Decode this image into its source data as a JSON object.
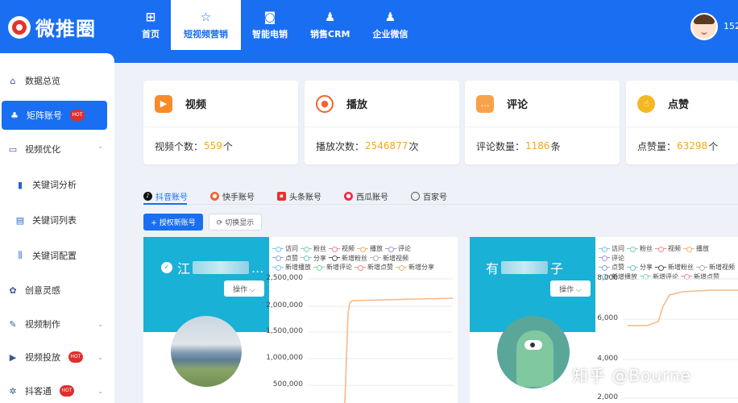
{
  "app": {
    "title": "微推圈"
  },
  "nav": [
    {
      "label": "首页",
      "icon": "grid-icon",
      "glyph": "⊞"
    },
    {
      "label": "短视频营销",
      "icon": "star-icon",
      "glyph": "☆"
    },
    {
      "label": "智能电销",
      "icon": "robot-icon",
      "glyph": "◙"
    },
    {
      "label": "销售CRM",
      "icon": "people-icon",
      "glyph": "♟"
    },
    {
      "label": "企业微信",
      "icon": "user-icon",
      "glyph": "♟"
    }
  ],
  "user": {
    "id_text": "152"
  },
  "sidebar": {
    "items": [
      {
        "label": "数据总览",
        "glyph": "⌂"
      },
      {
        "label": "矩阵账号",
        "glyph": "♣",
        "badge": "HOT"
      },
      {
        "label": "视频优化",
        "glyph": "▭",
        "caret": "⌃"
      },
      {
        "label": "关键词分析",
        "glyph": "▮"
      },
      {
        "label": "关键词列表",
        "glyph": "▤"
      },
      {
        "label": "关键词配置",
        "glyph": "⫼"
      },
      {
        "label": "创意灵感",
        "glyph": "✿"
      },
      {
        "label": "视频制作",
        "glyph": "✎",
        "caret": "⌄"
      },
      {
        "label": "视频投放",
        "glyph": "▶",
        "badge": "HOT",
        "caret": "⌄"
      },
      {
        "label": "抖客通",
        "glyph": "✲",
        "badge": "HOT",
        "caret": "⌄"
      }
    ]
  },
  "stats": [
    {
      "title": "视频",
      "label": "视频个数：",
      "value": "559",
      "unit": "个",
      "color": "#f98a2a",
      "icon": "video-icon",
      "glyph": "▶"
    },
    {
      "title": "播放",
      "label": "播放次数：",
      "value": "2546877",
      "unit": "次",
      "color": "#f3642d",
      "icon": "play-icon",
      "glyph": "●"
    },
    {
      "title": "评论",
      "label": "评论数量：",
      "value": "1186",
      "unit": "条",
      "color": "#f7a24b",
      "icon": "comment-icon",
      "glyph": "…"
    },
    {
      "title": "点赞",
      "label": "点赞量：",
      "value": "63298",
      "unit": "个",
      "color": "#f5b722",
      "icon": "like-icon",
      "glyph": "☝"
    }
  ],
  "platform_tabs": [
    {
      "label": "抖音账号",
      "color": "#111111",
      "icon": "douyin-icon",
      "glyph": "♪"
    },
    {
      "label": "快手账号",
      "color": "#f5622d",
      "icon": "kuaishou-icon",
      "glyph": "●"
    },
    {
      "label": "头条账号",
      "color": "#e9322e",
      "icon": "toutiao-icon",
      "glyph": "▪"
    },
    {
      "label": "西瓜账号",
      "color": "#f0294a",
      "icon": "xigua-icon",
      "glyph": "●"
    },
    {
      "label": "百家号",
      "color": "#555555",
      "icon": "baijia-icon",
      "glyph": "◌"
    }
  ],
  "actions": {
    "authorize": "+ 授权新账号",
    "switch": "⟳ 切换显示"
  },
  "accounts": [
    {
      "name_start": "江",
      "name_end": "...",
      "op_label": "操作 ⌵",
      "legend_rows": [
        [
          "访问",
          "粉丝",
          "视频",
          "播放",
          "评论"
        ],
        [
          "点赞",
          "分享",
          "新增粉丝",
          "新增视频"
        ],
        [
          "新增播放",
          "新增评论",
          "新增点赞",
          "新增分享"
        ]
      ],
      "y_ticks": [
        "2,500,000",
        "2,000,000",
        "1,500,000",
        "1,000,000",
        "500,000"
      ]
    },
    {
      "name_start": "有",
      "name_end": "子",
      "op_label": "操作 ⌵",
      "legend_rows": [
        [
          "访问",
          "粉丝",
          "视频",
          "播放",
          "评论"
        ],
        [
          "点赞",
          "分享",
          "新增粉丝",
          "新增视频"
        ],
        [
          "新增播放",
          "新增评论",
          "新增点赞"
        ]
      ],
      "y_ticks": [
        "8,000",
        "6,000",
        "4,000",
        "2,000"
      ]
    }
  ],
  "legend_colors": [
    "#7ac7e8",
    "#7fd3a5",
    "#f08a8a",
    "#f5b070",
    "#a896d8",
    "#8aa9d8",
    "#79c6c0",
    "#555555",
    "#b0b0b0"
  ],
  "series_color": "#f7b98a",
  "watermark": "知乎 @Bourne"
}
